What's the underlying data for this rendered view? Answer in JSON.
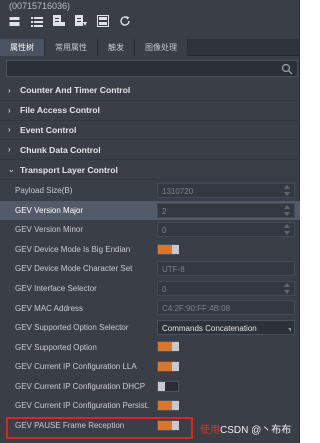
{
  "device_title": "(00715716036)",
  "toolbar": {
    "icons": [
      "grid-icon",
      "list-icon",
      "category-icon",
      "category-sort-icon",
      "folder-icon",
      "refresh-icon"
    ]
  },
  "tabs": [
    "属性树",
    "常用属性",
    "触发",
    "图像处理"
  ],
  "search": {
    "value": "",
    "placeholder": ""
  },
  "categories": [
    "Counter And Timer Control",
    "File Access Control",
    "Event Control",
    "Chunk Data Control",
    "Transport Layer Control"
  ],
  "params": [
    {
      "name": "Payload Size(B)",
      "value": "1310720",
      "kind": "spin"
    },
    {
      "name": "GEV Version Major",
      "value": "2",
      "kind": "spin",
      "selected": true
    },
    {
      "name": "GEV Version Minor",
      "value": "0",
      "kind": "spin"
    },
    {
      "name": "GEV Device Mode Is Big Endian",
      "kind": "toggle",
      "on": true
    },
    {
      "name": "GEV Device Mode Character Set",
      "value": "UTF-8",
      "kind": "box"
    },
    {
      "name": "GEV Interface Selector",
      "value": "0",
      "kind": "spin"
    },
    {
      "name": "GEV MAC Address",
      "value": "C4:2F:90:FF:4B:08",
      "kind": "box"
    },
    {
      "name": "GEV Supported Option Selector",
      "value": "Commands Concatenation",
      "kind": "combo"
    },
    {
      "name": "GEV Supported Option",
      "kind": "toggle",
      "on": true
    },
    {
      "name": "GEV Current IP Configuration LLA",
      "kind": "toggle",
      "on": true
    },
    {
      "name": "GEV Current IP Configuration DHCP",
      "kind": "toggle",
      "on": false
    },
    {
      "name": "GEV Current IP Configuration Persist...",
      "kind": "toggle",
      "on": true
    },
    {
      "name": "GEV PAUSE Frame Reception",
      "kind": "toggle",
      "on": true
    }
  ],
  "watermark": {
    "prefix": "使用",
    "text": "CSDN @丶布布"
  },
  "colors": {
    "panel": "#3a3f47",
    "accent": "#d8782e",
    "selected_row": "#545b68",
    "highlight": "#d8281e"
  }
}
